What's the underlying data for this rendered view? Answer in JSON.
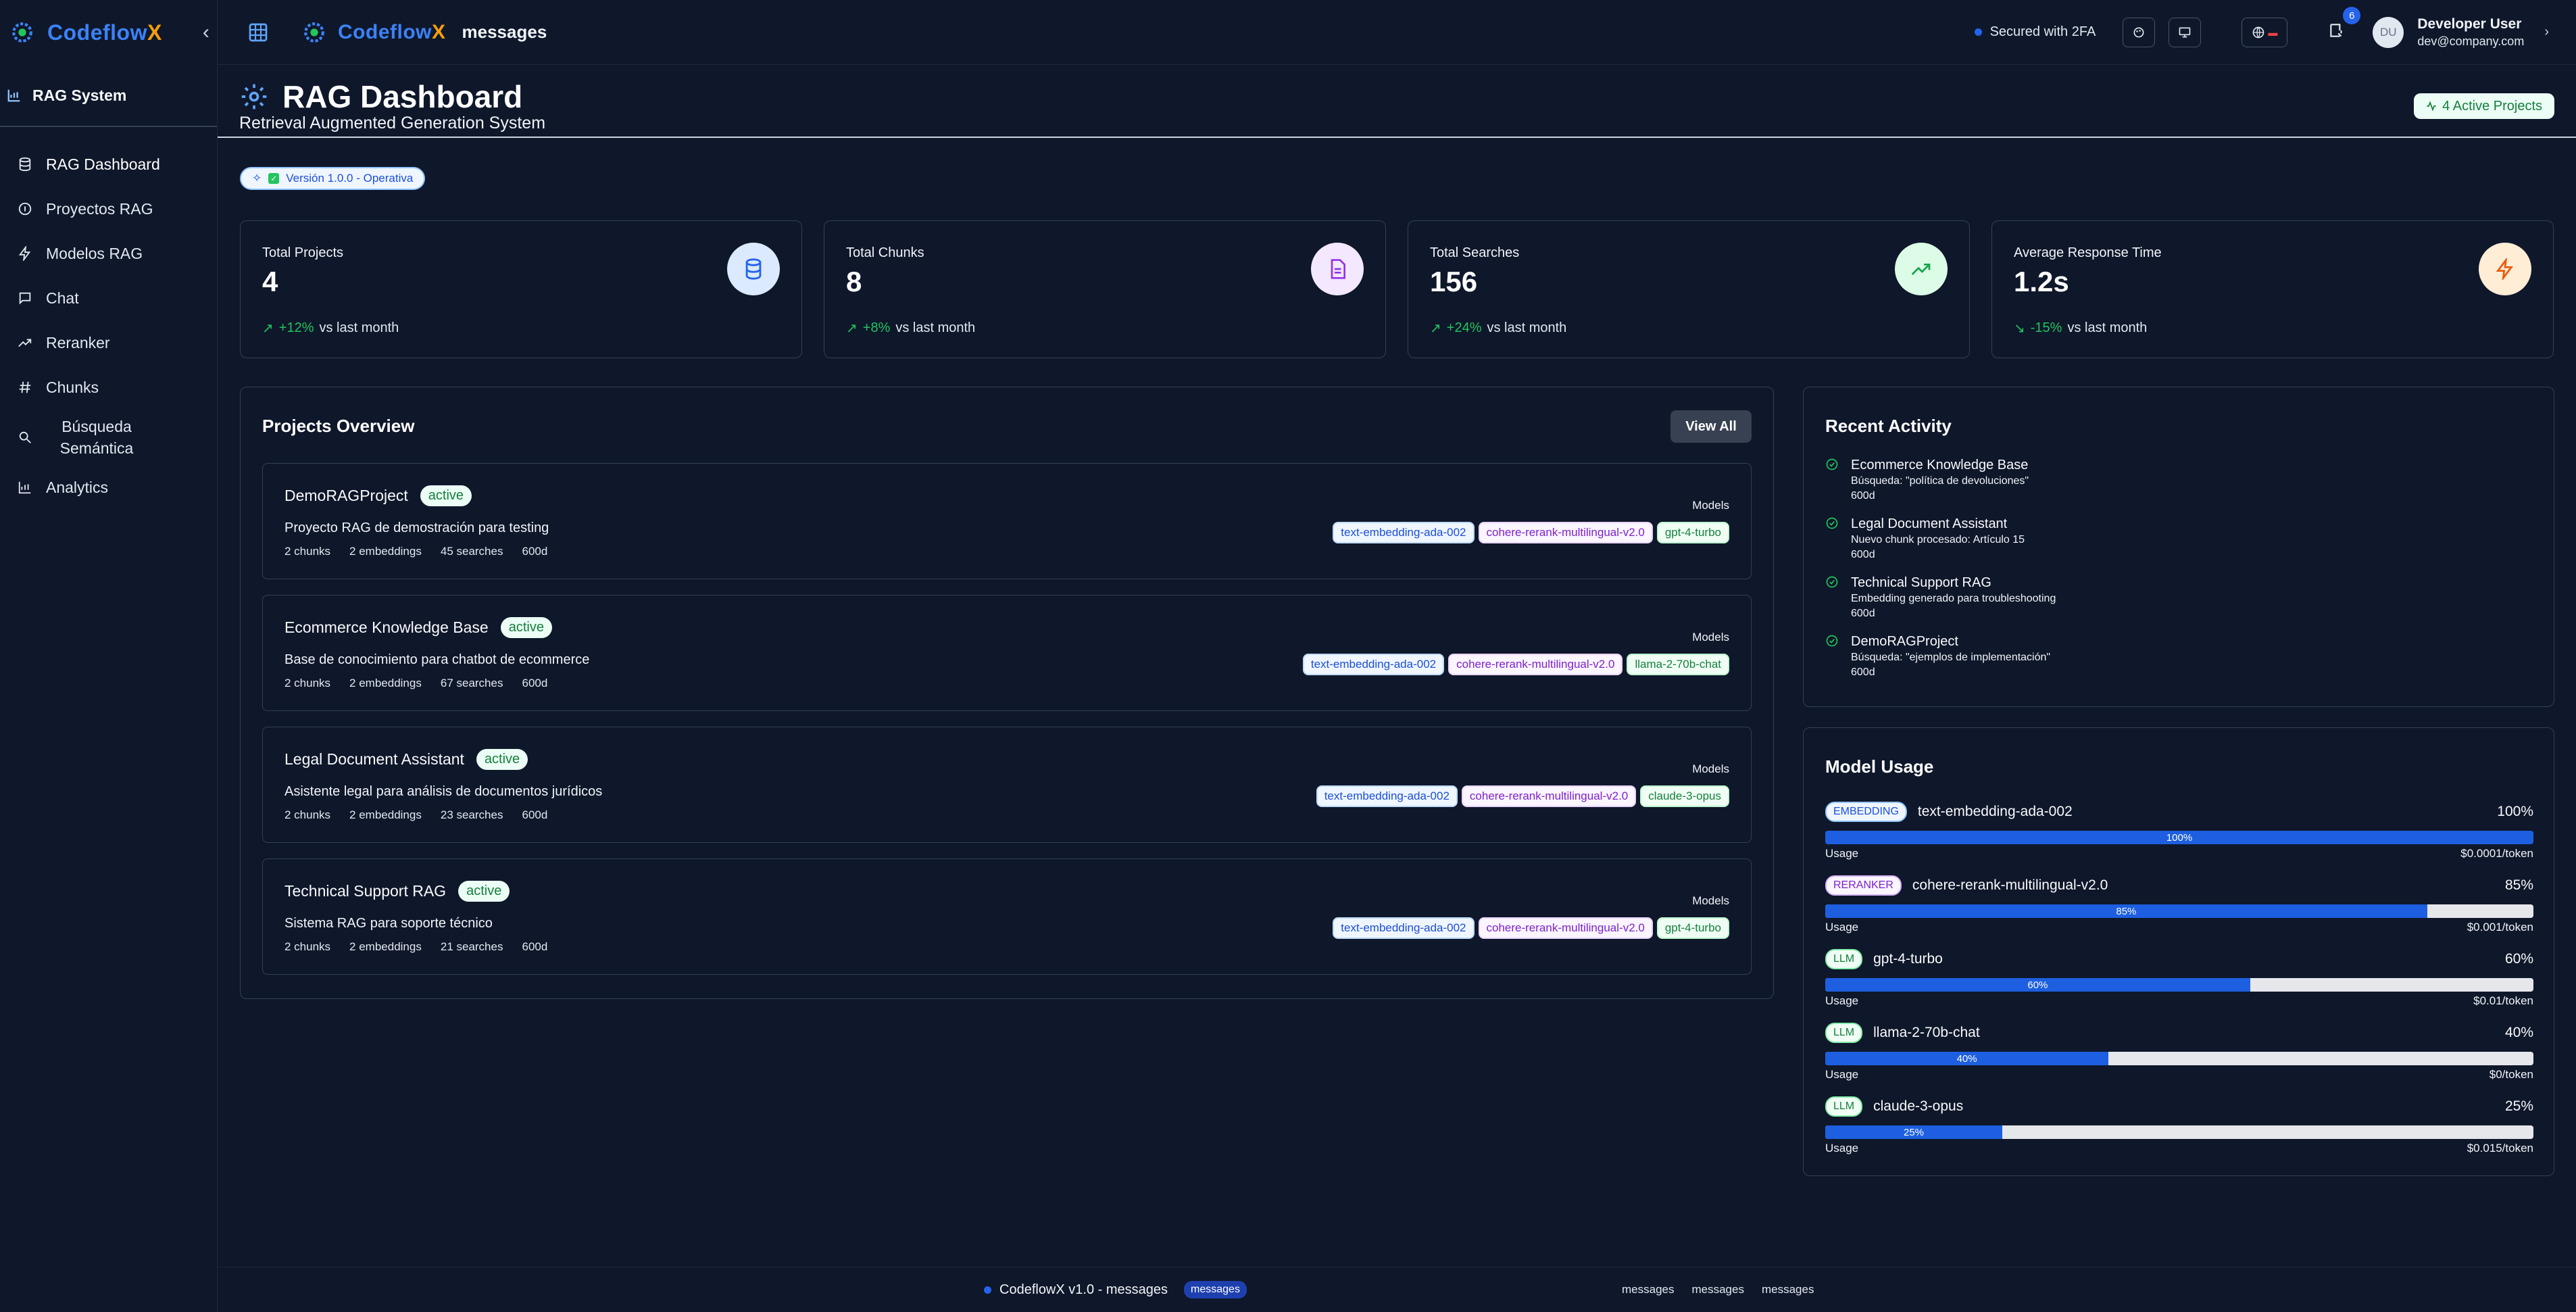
{
  "app": {
    "brand_a": "Codeflow",
    "brand_b": "X",
    "page": "messages"
  },
  "sidebar": {
    "section": "RAG System",
    "items": [
      {
        "label": "RAG Dashboard",
        "icon": "database-icon"
      },
      {
        "label": "Proyectos RAG",
        "icon": "info-icon"
      },
      {
        "label": "Modelos RAG",
        "icon": "bolt-icon"
      },
      {
        "label": "Chat",
        "icon": "chat-icon"
      },
      {
        "label": "Reranker",
        "icon": "trend-icon"
      },
      {
        "label": "Chunks",
        "icon": "hash-icon"
      },
      {
        "label": "Búsqueda Semántica",
        "icon": "search-icon"
      },
      {
        "label": "Analytics",
        "icon": "chart-icon"
      }
    ]
  },
  "topbar": {
    "secured": "Secured with 2FA",
    "notifications": "6",
    "avatar_initials": "DU",
    "user_name": "Developer User",
    "user_email": "dev@company.com"
  },
  "header": {
    "title": "RAG Dashboard",
    "subtitle": "Retrieval Augmented Generation System",
    "active_projects": "4 Active Projects",
    "version": "Versión 1.0.0 - Operativa"
  },
  "stats": [
    {
      "label": "Total Projects",
      "value": "4",
      "pct": "+12%",
      "suffix": "vs last month",
      "icon": "database-icon",
      "color": "#2563eb",
      "bg": "#dbeafe"
    },
    {
      "label": "Total Chunks",
      "value": "8",
      "pct": "+8%",
      "suffix": "vs last month",
      "icon": "document-icon",
      "color": "#9333ea",
      "bg": "#f3e8ff"
    },
    {
      "label": "Total Searches",
      "value": "156",
      "pct": "+24%",
      "suffix": "vs last month",
      "icon": "trend-up-icon",
      "color": "#16a34a",
      "bg": "#dcfce7"
    },
    {
      "label": "Average Response Time",
      "value": "1.2s",
      "pct": "-15%",
      "suffix": "vs last month",
      "icon": "bolt-icon",
      "color": "#ea580c",
      "bg": "#ffedd5"
    }
  ],
  "projects": {
    "title": "Projects Overview",
    "view_all": "View All",
    "models_label": "Models",
    "items": [
      {
        "name": "DemoRAGProject",
        "status": "active",
        "desc": "Proyecto RAG de demostración para testing",
        "chunks": "2 chunks",
        "embeddings": "2 embeddings",
        "searches": "45 searches",
        "age": "600d",
        "models": [
          {
            "name": "text-embedding-ada-002",
            "kind": "emb"
          },
          {
            "name": "cohere-rerank-multilingual-v2.0",
            "kind": "rer"
          },
          {
            "name": "gpt-4-turbo",
            "kind": "llm"
          }
        ]
      },
      {
        "name": "Ecommerce Knowledge Base",
        "status": "active",
        "desc": "Base de conocimiento para chatbot de ecommerce",
        "chunks": "2 chunks",
        "embeddings": "2 embeddings",
        "searches": "67 searches",
        "age": "600d",
        "models": [
          {
            "name": "text-embedding-ada-002",
            "kind": "emb"
          },
          {
            "name": "cohere-rerank-multilingual-v2.0",
            "kind": "rer"
          },
          {
            "name": "llama-2-70b-chat",
            "kind": "llm"
          }
        ]
      },
      {
        "name": "Legal Document Assistant",
        "status": "active",
        "desc": "Asistente legal para análisis de documentos jurídicos",
        "chunks": "2 chunks",
        "embeddings": "2 embeddings",
        "searches": "23 searches",
        "age": "600d",
        "models": [
          {
            "name": "text-embedding-ada-002",
            "kind": "emb"
          },
          {
            "name": "cohere-rerank-multilingual-v2.0",
            "kind": "rer"
          },
          {
            "name": "claude-3-opus",
            "kind": "llm"
          }
        ]
      },
      {
        "name": "Technical Support RAG",
        "status": "active",
        "desc": "Sistema RAG para soporte técnico",
        "chunks": "2 chunks",
        "embeddings": "2 embeddings",
        "searches": "21 searches",
        "age": "600d",
        "models": [
          {
            "name": "text-embedding-ada-002",
            "kind": "emb"
          },
          {
            "name": "cohere-rerank-multilingual-v2.0",
            "kind": "rer"
          },
          {
            "name": "gpt-4-turbo",
            "kind": "llm"
          }
        ]
      }
    ]
  },
  "activity": {
    "title": "Recent Activity",
    "items": [
      {
        "name": "Ecommerce Knowledge Base",
        "desc": "Búsqueda: \"política de devoluciones\"",
        "time": "600d"
      },
      {
        "name": "Legal Document Assistant",
        "desc": "Nuevo chunk procesado: Artículo 15",
        "time": "600d"
      },
      {
        "name": "Technical Support RAG",
        "desc": "Embedding generado para troubleshooting",
        "time": "600d"
      },
      {
        "name": "DemoRAGProject",
        "desc": "Búsqueda: \"ejemplos de implementación\"",
        "time": "600d"
      }
    ]
  },
  "usage": {
    "title": "Model Usage",
    "usage_label": "Usage",
    "items": [
      {
        "type": "EMBEDDING",
        "kind": "emb",
        "name": "text-embedding-ada-002",
        "pct": "100%",
        "value": 100,
        "cost": "$0.0001/token"
      },
      {
        "type": "RERANKER",
        "kind": "rer",
        "name": "cohere-rerank-multilingual-v2.0",
        "pct": "85%",
        "value": 85,
        "cost": "$0.001/token"
      },
      {
        "type": "LLM",
        "kind": "llm",
        "name": "gpt-4-turbo",
        "pct": "60%",
        "value": 60,
        "cost": "$0.01/token"
      },
      {
        "type": "LLM",
        "kind": "llm",
        "name": "llama-2-70b-chat",
        "pct": "40%",
        "value": 40,
        "cost": "$0/token"
      },
      {
        "type": "LLM",
        "kind": "llm",
        "name": "claude-3-opus",
        "pct": "25%",
        "value": 25,
        "cost": "$0.015/token"
      }
    ]
  },
  "footer": {
    "text": "CodeflowX v1.0 - messages",
    "badge": "messages",
    "links": [
      "messages",
      "messages",
      "messages"
    ]
  }
}
